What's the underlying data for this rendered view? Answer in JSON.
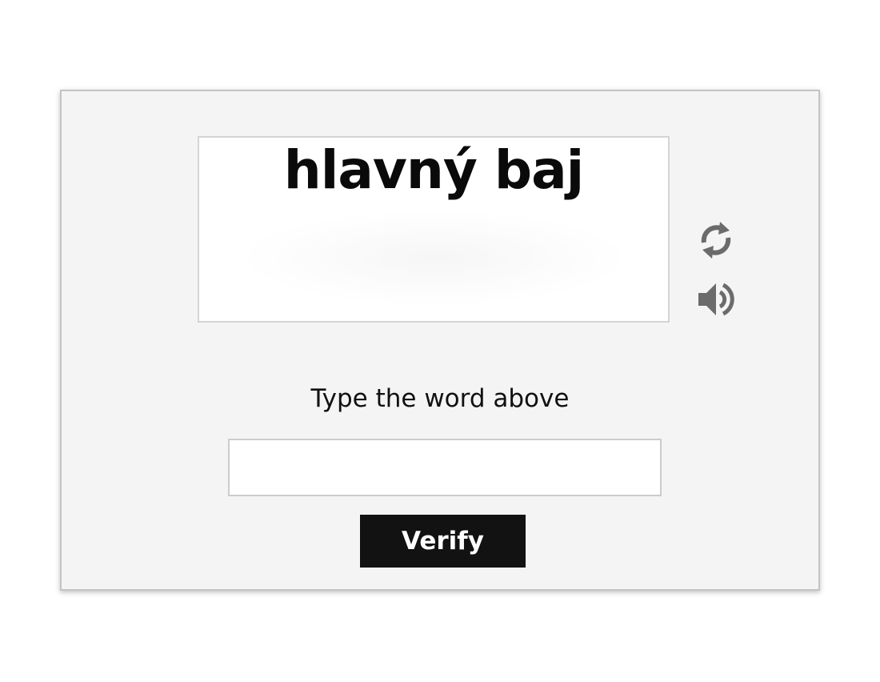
{
  "captcha": {
    "word": "hlavný baj",
    "refresh_icon": "refresh-icon",
    "audio_icon": "speaker-icon"
  },
  "form": {
    "instruction": "Type the word above",
    "answer_value": "",
    "answer_placeholder": "",
    "verify_label": "Verify"
  },
  "colors": {
    "panel_background": "#f4f4f4",
    "button_background": "#121212",
    "icon_color": "#6b6b6b"
  }
}
